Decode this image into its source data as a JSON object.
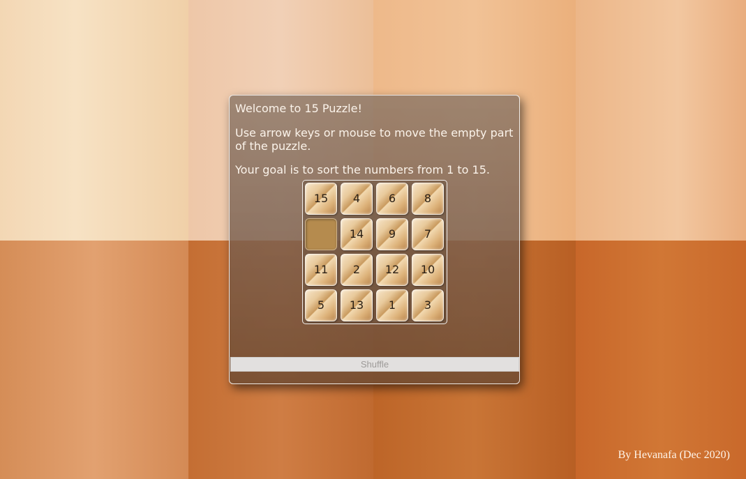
{
  "intro": {
    "welcome": "Welcome to 15 Puzzle!",
    "instructions": "Use arrow keys or mouse to move the empty part of the puzzle.",
    "goal": "Your goal is to sort the numbers from 1 to 15."
  },
  "board": {
    "tiles": [
      "15",
      "4",
      "6",
      "8",
      "",
      "14",
      "9",
      "7",
      "11",
      "2",
      "12",
      "10",
      "5",
      "13",
      "1",
      "3"
    ],
    "empty_index": 4
  },
  "controls": {
    "shuffle_label": "Shuffle"
  },
  "footer": {
    "credit": "By Hevanafa (Dec 2020)"
  }
}
